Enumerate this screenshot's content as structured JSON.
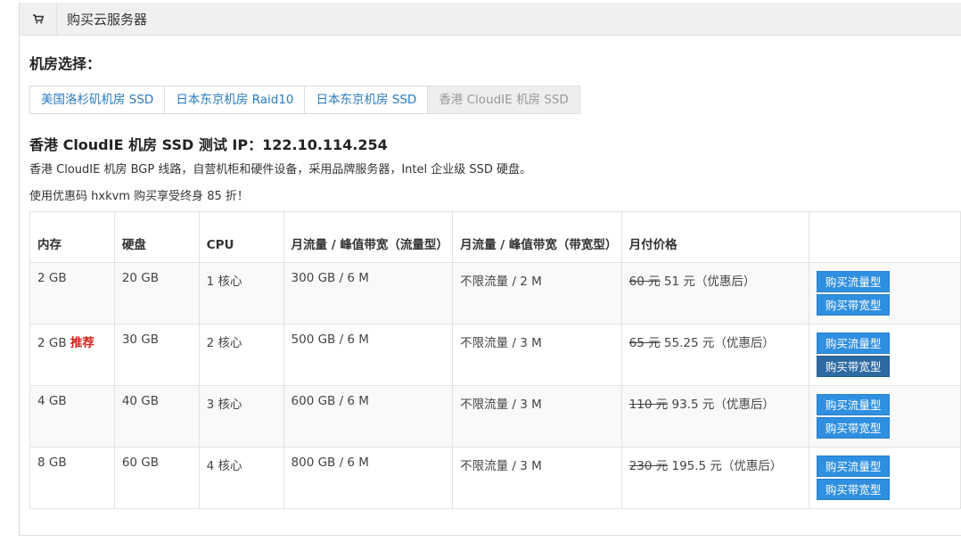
{
  "header": {
    "icon": "cart-icon",
    "title": "购买云服务器"
  },
  "section_label": "机房选择：",
  "tabs": [
    {
      "label": "美国洛杉矶机房 SSD",
      "active": false
    },
    {
      "label": "日本东京机房 Raid10",
      "active": false
    },
    {
      "label": "日本东京机房 SSD",
      "active": false
    },
    {
      "label": "香港 CloudIE 机房 SSD",
      "active": true
    }
  ],
  "room": {
    "title": "香港 CloudIE 机房 SSD 测试 IP：122.10.114.254",
    "desc1": "香港 CloudIE 机房 BGP 线路，自营机柜和硬件设备，采用品牌服务器，Intel 企业级 SSD 硬盘。",
    "desc2": "使用优惠码 hxkvm 购买享受终身 85 折！"
  },
  "table": {
    "headers": [
      "内存",
      "硬盘",
      "CPU",
      "月流量 / 峰值带宽（流量型）",
      "月流量 / 峰值带宽（带宽型）",
      "月付价格",
      ""
    ],
    "rows": [
      {
        "memory": "2 GB",
        "badge": "",
        "disk": "20 GB",
        "cpu": "1 核心",
        "traffic": "300 GB / 6 M",
        "bandwidth": "不限流量 / 2 M",
        "old_price": "60 元",
        "new_price": " 51 元（优惠后）"
      },
      {
        "memory": "2 GB",
        "badge": "推荐",
        "disk": "30 GB",
        "cpu": "2 核心",
        "traffic": "500 GB / 6 M",
        "bandwidth": "不限流量 / 3 M",
        "old_price": "65 元",
        "new_price": " 55.25 元（优惠后）"
      },
      {
        "memory": "4 GB",
        "badge": "",
        "disk": "40 GB",
        "cpu": "3 核心",
        "traffic": "600 GB / 6 M",
        "bandwidth": "不限流量 / 3 M",
        "old_price": "110 元",
        "new_price": " 93.5 元（优惠后）"
      },
      {
        "memory": "8 GB",
        "badge": "",
        "disk": "60 GB",
        "cpu": "4 核心",
        "traffic": "800 GB / 6 M",
        "bandwidth": "不限流量 / 3 M",
        "old_price": "230 元",
        "new_price": " 195.5 元（优惠后）"
      }
    ],
    "buy_traffic_label": "购买流量型",
    "buy_bandwidth_label": "购买带宽型"
  },
  "colors": {
    "link": "#2a7bbf",
    "button": "#2f8fe0",
    "recommend": "#d9231c"
  }
}
